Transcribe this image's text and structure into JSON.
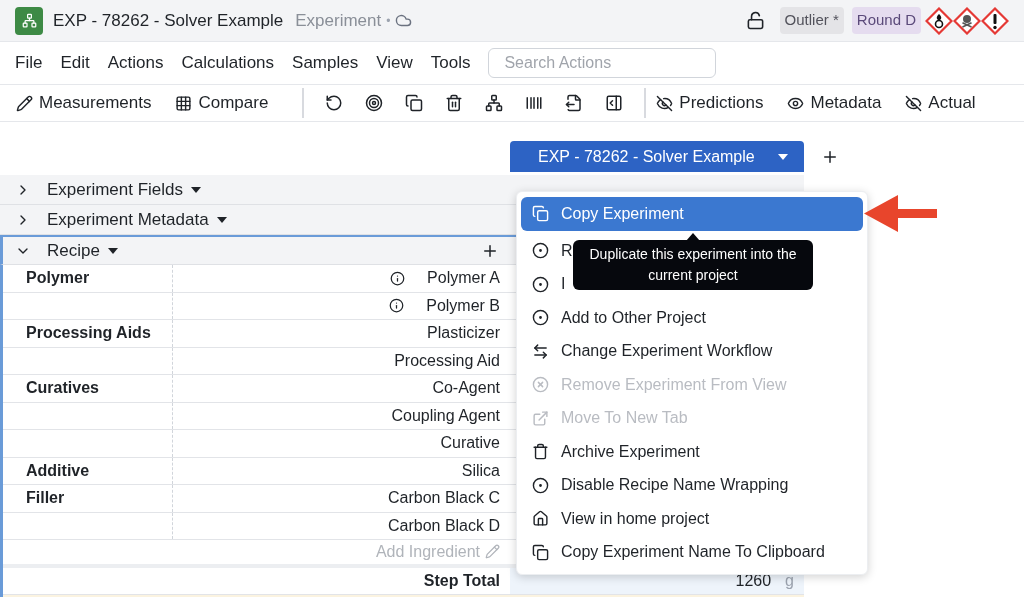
{
  "header": {
    "title": "EXP - 78262 - Solver Example",
    "subtitle": "Experiment",
    "separator": "•",
    "badges": [
      {
        "label": "Outlier *",
        "color": "#e4e4e7"
      },
      {
        "label": "Round D",
        "color": "#e5dcef"
      }
    ],
    "hazards": [
      {
        "kind": "flame"
      },
      {
        "kind": "skull"
      },
      {
        "kind": "exclamation"
      }
    ]
  },
  "menu_bar": {
    "items": [
      "File",
      "Edit",
      "Actions",
      "Calculations",
      "Samples",
      "View",
      "Tools"
    ],
    "search": {
      "placeholder": "Search Actions"
    }
  },
  "toolbar": [
    {
      "kind": "pencil",
      "label": "Measurements"
    },
    {
      "kind": "grid",
      "label": "Compare"
    },
    {
      "kind": "separator"
    },
    {
      "kind": "undo"
    },
    {
      "kind": "target"
    },
    {
      "kind": "copy"
    },
    {
      "kind": "trash"
    },
    {
      "kind": "network"
    },
    {
      "kind": "barcode"
    },
    {
      "kind": "export"
    },
    {
      "kind": "panel"
    },
    {
      "kind": "separator"
    },
    {
      "kind": "eye-off",
      "label": "Predictions"
    },
    {
      "kind": "eye",
      "label": "Metadata"
    },
    {
      "kind": "eye-off",
      "label": "Actual"
    }
  ],
  "tab": {
    "label": "EXP - 78262 - Solver Example",
    "selected": true
  },
  "sections": [
    {
      "title": "Experiment Fields",
      "expanded": false
    },
    {
      "title": "Experiment Metadata",
      "expanded": false
    },
    {
      "title": "Recipe",
      "expanded": true
    }
  ],
  "recipe": {
    "rows": [
      {
        "category": "Polymer",
        "ingredient": "Polymer A",
        "info": true
      },
      {
        "ingredient": "Polymer B",
        "info": true
      },
      {
        "category": "Processing Aids",
        "ingredient": "Plasticizer",
        "info": false
      },
      {
        "ingredient": "Processing Aid",
        "info": false
      },
      {
        "category": "Curatives",
        "ingredient": "Co-Agent",
        "info": false
      },
      {
        "ingredient": "Coupling Agent",
        "info": false
      },
      {
        "ingredient": "Curative",
        "info": false
      },
      {
        "category": "Additive",
        "ingredient": "Silica",
        "info": false
      },
      {
        "category": "Filler",
        "ingredient": "Carbon Black C",
        "info": false
      },
      {
        "ingredient": "Carbon Black D",
        "info": false
      }
    ],
    "add_ingredient": "Add Ingredient",
    "step_total": {
      "label": "Step Total",
      "value": "1260",
      "unit": "g"
    }
  },
  "context_menu": {
    "items": [
      {
        "kind": "copy",
        "label": "Copy Experiment",
        "selected": true,
        "disabled": false
      },
      {
        "kind": "dot",
        "label": "R",
        "selected": false,
        "disabled": false
      },
      {
        "kind": "dot",
        "label": "I",
        "selected": false,
        "disabled": false
      },
      {
        "kind": "dot",
        "label": "Add to Other Project",
        "selected": false,
        "disabled": false
      },
      {
        "kind": "swap",
        "label": "Change Experiment Workflow",
        "selected": false,
        "disabled": false
      },
      {
        "kind": "remove",
        "label": "Remove Experiment From View",
        "selected": false,
        "disabled": true
      },
      {
        "kind": "external",
        "label": "Move To New Tab",
        "selected": false,
        "disabled": true
      },
      {
        "kind": "trash",
        "label": "Archive Experiment",
        "selected": false,
        "disabled": false
      },
      {
        "kind": "dot",
        "label": "Disable Recipe Name Wrapping",
        "selected": false,
        "disabled": false
      },
      {
        "kind": "home",
        "label": "View in home project",
        "selected": false,
        "disabled": false
      },
      {
        "kind": "copy",
        "label": "Copy Experiment Name To Clipboard",
        "selected": false,
        "disabled": false
      }
    ],
    "tooltip": "Duplicate this experiment into the current project"
  }
}
